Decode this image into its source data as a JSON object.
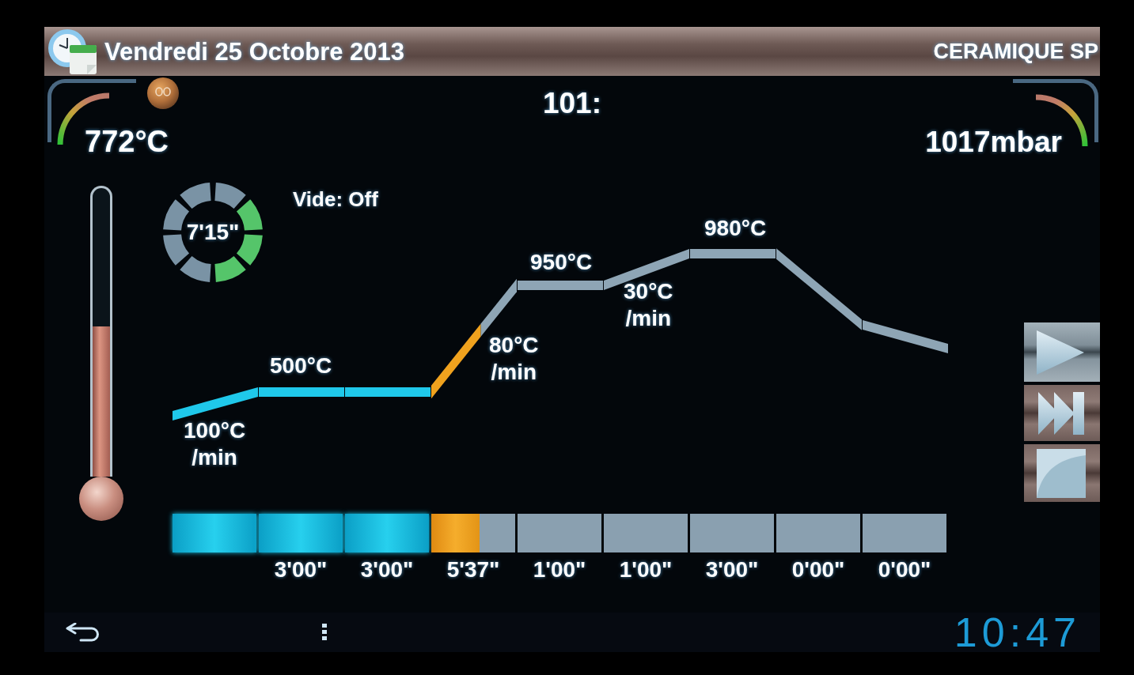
{
  "title_bar": {
    "date": "Vendredi 25 Octobre 2013",
    "program_name": "CERAMIQUE SP"
  },
  "temperature_gauge": {
    "reading": "772°C"
  },
  "program_number": "101:",
  "pressure_gauge": {
    "reading": "1017mbar"
  },
  "thermometer": {
    "level": 0.52
  },
  "timer": {
    "reading": "7'15\"",
    "segments": [
      {
        "on": false
      },
      {
        "on": true
      },
      {
        "on": true
      },
      {
        "on": true
      },
      {
        "on": false
      },
      {
        "on": false
      },
      {
        "on": false
      },
      {
        "on": false
      }
    ]
  },
  "vacuum_status": "Vide: Off",
  "firing_program": {
    "segments": [
      {
        "done": true,
        "active": false,
        "label": "100°C /min"
      },
      {
        "done": true,
        "active": false,
        "label": "500°C",
        "duration": "3'00\""
      },
      {
        "done": true,
        "active": false,
        "duration": "3'00\""
      },
      {
        "done": false,
        "active": true,
        "level": 0.58,
        "label": "80°C /min",
        "duration": "5'37\""
      },
      {
        "done": false,
        "active": false,
        "label": "950°C",
        "duration": "1'00\""
      },
      {
        "done": false,
        "active": false,
        "label": "30°C /min",
        "duration": "1'00\""
      },
      {
        "done": false,
        "active": false,
        "label": "980°C",
        "duration": "3'00\""
      },
      {
        "done": false,
        "active": false,
        "duration": "0'00\""
      },
      {
        "done": false,
        "active": false,
        "duration": "0'00\""
      }
    ]
  },
  "nav_bar": {
    "clock": "10:47"
  }
}
